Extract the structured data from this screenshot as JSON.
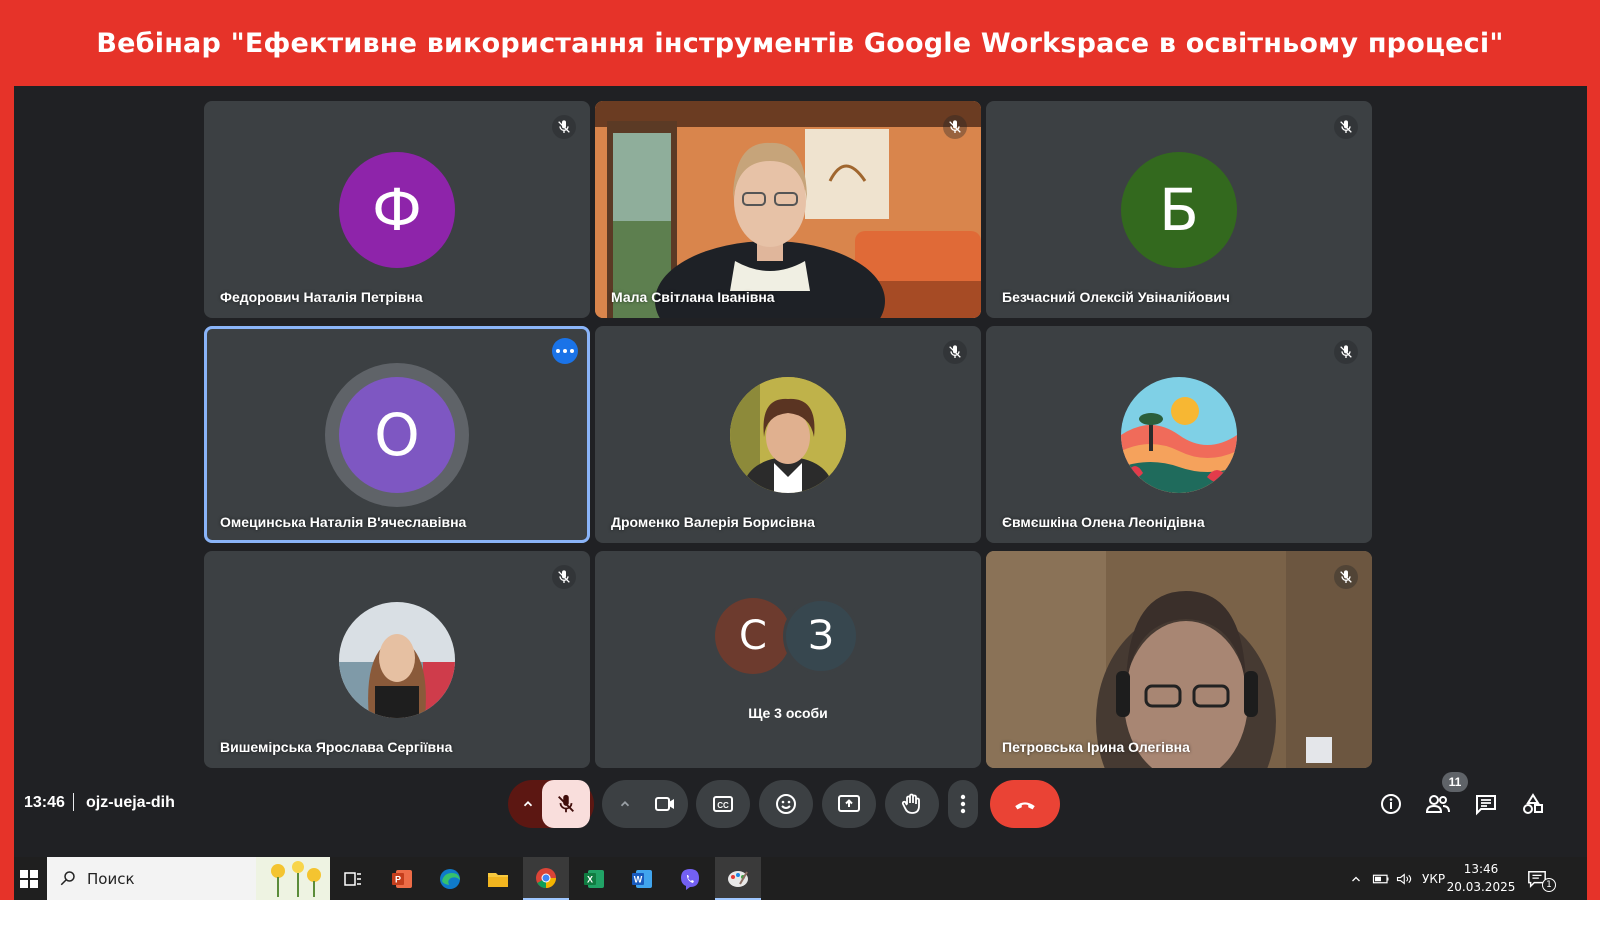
{
  "banner": {
    "title": "Вебінар \"Ефективне використання інструментів Google Workspace в освітньому процесі\""
  },
  "tiles": [
    {
      "name": "Федорович Наталія Петрівна",
      "initial": "Ф",
      "avatar_color": "#8e24aa",
      "muted": true
    },
    {
      "name": "Мала Світлана Іванівна",
      "type": "video",
      "muted": true
    },
    {
      "name": "Безчасний Олексій Увіналійович",
      "initial": "Б",
      "avatar_color": "#33691e",
      "muted": true
    },
    {
      "name": "Омецинська Наталія В'ячеславівна",
      "initial": "О",
      "avatar_color": "#7e57c2",
      "active_speaker": true
    },
    {
      "name": "Дроменко Валерія Борисівна",
      "type": "photo",
      "muted": true
    },
    {
      "name": "Євмєшкіна Олена Леонідівна",
      "type": "photo",
      "muted": true
    },
    {
      "name": "Вишемірська Ярослава Сергіївна",
      "type": "photo",
      "muted": true
    },
    {
      "others_label": "Ще 3 особи",
      "initials": [
        "С",
        "З"
      ],
      "colors": [
        "#6d3b2e",
        "#37474f"
      ]
    },
    {
      "name": "Петровська Ірина Олегівна",
      "type": "video",
      "muted": true
    }
  ],
  "meeting": {
    "time": "13:46",
    "code": "ojz-ueja-dih",
    "participants_count": "11"
  },
  "taskbar": {
    "search_placeholder": "Поиск",
    "lang": "УКР",
    "time": "13:46",
    "date": "20.03.2025",
    "notif_count": "1"
  },
  "colors": {
    "banner": "#e63329",
    "meet_bg": "#202124",
    "tile_bg": "#3c4043",
    "end_call": "#ea4335",
    "active_outline": "#8ab4f8"
  }
}
